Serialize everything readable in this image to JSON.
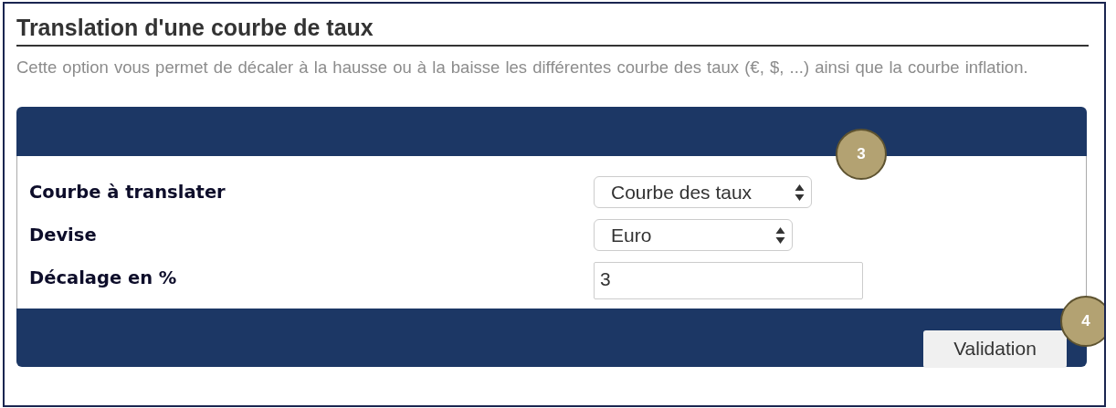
{
  "title": "Translation d'une courbe de taux",
  "description": "Cette option vous permet de décaler à la hausse ou à la baisse les différentes courbe des taux (€, $, ...) ainsi que la courbe inflation.",
  "form": {
    "fields": [
      {
        "label": "Courbe à translater",
        "kind": "select",
        "value": "Courbe des taux",
        "callout": "3"
      },
      {
        "label": "Devise",
        "kind": "select",
        "value": "Euro"
      },
      {
        "label": "Décalage en %",
        "kind": "input",
        "value": "3"
      }
    ],
    "submit": {
      "label": "Validation",
      "callout": "4"
    }
  }
}
